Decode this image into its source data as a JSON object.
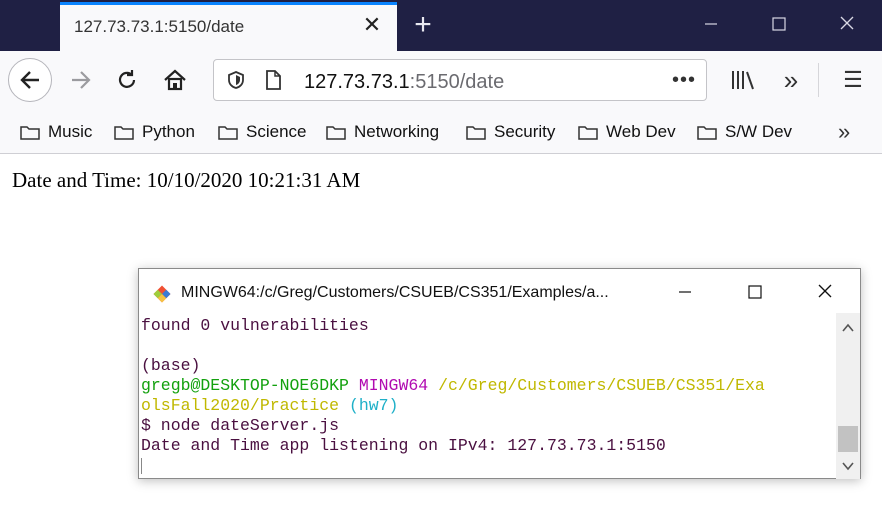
{
  "browser": {
    "tab": {
      "title": "127.73.73.1:5150/date",
      "close_glyph": "✕"
    },
    "new_tab_glyph": "+",
    "window_controls": {
      "minimize": "—",
      "maximize": "☐",
      "close": "✕"
    },
    "url": {
      "host": "127.73.73.1",
      "rest": ":5150/date"
    },
    "page_actions": "•••",
    "bookmarks": [
      {
        "label": "Music"
      },
      {
        "label": "Python"
      },
      {
        "label": "Science"
      },
      {
        "label": "Networking"
      },
      {
        "label": "Security"
      },
      {
        "label": "Web Dev"
      },
      {
        "label": "S/W Dev"
      }
    ],
    "bookmarks_overflow": "»",
    "toolbar_overflow": "»",
    "menu_glyph": "☰",
    "colors": {
      "tabstrip": "#1f2044",
      "accent": "#0a84ff"
    }
  },
  "page": {
    "content": "Date and Time: 10/10/2020 10:21:31 AM"
  },
  "terminal": {
    "title": "MINGW64:/c/Greg/Customers/CSUEB/CS351/Examples/a...",
    "controls": {
      "minimize": "—",
      "maximize": "☐",
      "close": "✕"
    },
    "lines": {
      "l1": "found 0 vulnerabilities",
      "l3": "(base)",
      "prompt_user": "gregb@DESKTOP-NOE6DKP",
      "prompt_sys": "MINGW64",
      "prompt_path_a": "/c/Greg/Customers/CSUEB/CS351/Exa",
      "prompt_path_b": "olsFall2020/Practice",
      "prompt_branch": "(hw7)",
      "cmd": "$ node dateServer.js",
      "output": "Date and Time app listening on IPv4: 127.73.73.1:5150"
    },
    "scroll_up": "⌃",
    "scroll_down": "⌄",
    "colors": {
      "user": "#13a10e",
      "system": "#b10ab1",
      "path": "#c0b800",
      "branch": "#1fb0c8",
      "text": "#4a1040"
    }
  }
}
